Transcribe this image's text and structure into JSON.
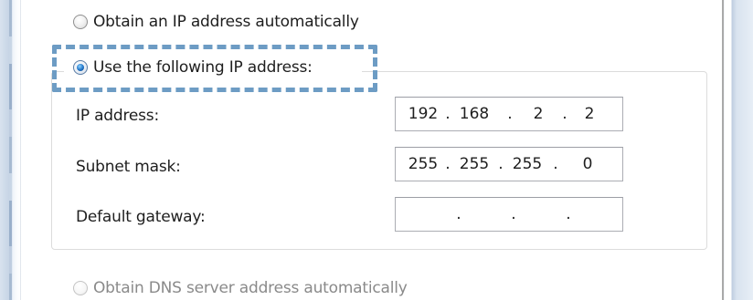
{
  "dialog": {
    "ip_options": {
      "auto_label": "Obtain an IP address automatically",
      "manual_label": "Use the following IP address:",
      "selected": "manual"
    },
    "fields": [
      {
        "label": "IP address:",
        "octets": [
          "192",
          "168",
          "2",
          "2"
        ]
      },
      {
        "label": "Subnet mask:",
        "octets": [
          "255",
          "255",
          "255",
          "0"
        ]
      },
      {
        "label": "Default gateway:",
        "octets": [
          "",
          "",
          "",
          ""
        ]
      }
    ],
    "ip_separator": ".",
    "dns_options": {
      "auto_label": "Obtain DNS server address automatically",
      "enabled": false
    }
  },
  "colors": {
    "highlight": "#6d9cc4",
    "radio_selected": "#1e73c8"
  }
}
